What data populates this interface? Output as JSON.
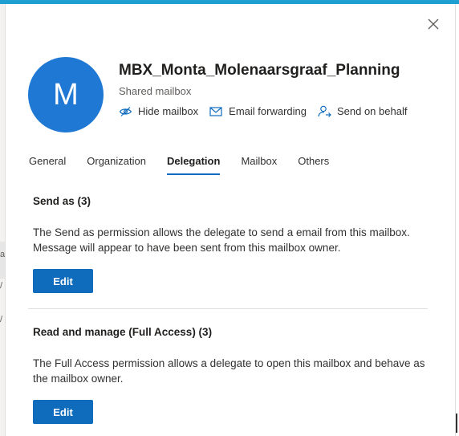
{
  "panel": {
    "close_label": "Close",
    "avatar_initial": "M",
    "title": "MBX_Monta_Molenaarsgraaf_Planning",
    "subtitle": "Shared mailbox"
  },
  "actions": [
    {
      "label": "Hide mailbox",
      "icon": "hide-mailbox-icon"
    },
    {
      "label": "Email forwarding",
      "icon": "email-forwarding-icon"
    },
    {
      "label": "Send on behalf",
      "icon": "send-on-behalf-icon"
    }
  ],
  "tabs": [
    {
      "label": "General",
      "active": false
    },
    {
      "label": "Organization",
      "active": false
    },
    {
      "label": "Delegation",
      "active": true
    },
    {
      "label": "Mailbox",
      "active": false
    },
    {
      "label": "Others",
      "active": false
    }
  ],
  "sections": {
    "send_as": {
      "title": "Send as (3)",
      "description": "The Send as permission allows the delegate to send a email from this mailbox. Message will appear to have been sent from this mailbox owner.",
      "button_label": "Edit"
    },
    "full_access": {
      "title": "Read and manage (Full Access) (3)",
      "description": "The Full Access permission allows a delegate to open this mailbox and behave as the mailbox owner.",
      "button_label": "Edit"
    }
  },
  "background_fragments": [
    "a",
    "/",
    "/"
  ],
  "colors": {
    "accent": "#0f6cbd",
    "avatar": "#1e78d4",
    "top_bar": "#1f9ed1"
  }
}
